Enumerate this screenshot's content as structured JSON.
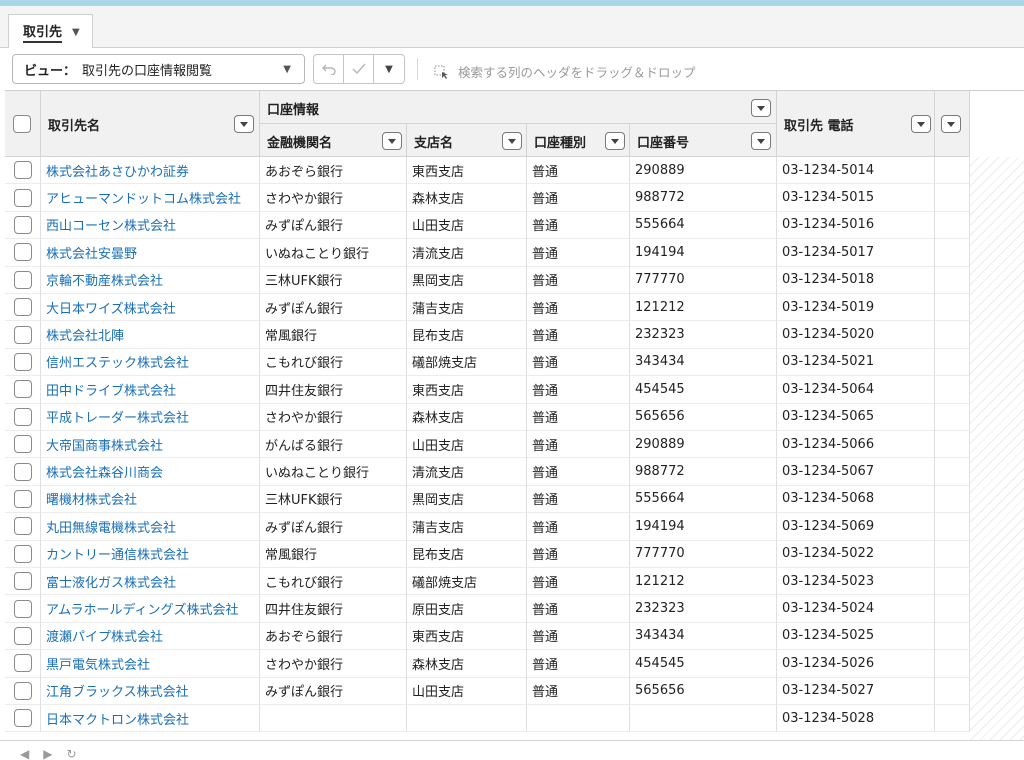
{
  "tabbar": {
    "tab_label": "取引先"
  },
  "toolbar": {
    "view_prefix": "ビュー：",
    "view_value": "取引先の口座情報閲覧",
    "drop_hint": "検索する列のヘッダをドラッグ＆ドロップ"
  },
  "grid": {
    "columns": {
      "name": "取引先名",
      "group": "口座情報",
      "bank": "金融機関名",
      "branch": "支店名",
      "type": "口座種別",
      "number": "口座番号",
      "phone": "取引先 電話"
    },
    "rows": [
      {
        "name": "株式会社あさひかわ証券",
        "bank": "あおぞら銀行",
        "branch": "東西支店",
        "type": "普通",
        "number": "290889",
        "phone": "03-1234-5014"
      },
      {
        "name": "アヒューマンドットコム株式会社",
        "bank": "さわやか銀行",
        "branch": "森林支店",
        "type": "普通",
        "number": "988772",
        "phone": "03-1234-5015"
      },
      {
        "name": "西山コーセン株式会社",
        "bank": "みずぽん銀行",
        "branch": "山田支店",
        "type": "普通",
        "number": "555664",
        "phone": "03-1234-5016"
      },
      {
        "name": "株式会社安曇野",
        "bank": "いぬねことり銀行",
        "branch": "清流支店",
        "type": "普通",
        "number": "194194",
        "phone": "03-1234-5017"
      },
      {
        "name": "京輪不動産株式会社",
        "bank": "三林UFK銀行",
        "branch": "黒岡支店",
        "type": "普通",
        "number": "777770",
        "phone": "03-1234-5018"
      },
      {
        "name": "大日本ワイズ株式会社",
        "bank": "みずぽん銀行",
        "branch": "蒲吉支店",
        "type": "普通",
        "number": "121212",
        "phone": "03-1234-5019"
      },
      {
        "name": "株式会社北陣",
        "bank": "常風銀行",
        "branch": "昆布支店",
        "type": "普通",
        "number": "232323",
        "phone": "03-1234-5020"
      },
      {
        "name": "信州エステック株式会社",
        "bank": "こもれび銀行",
        "branch": "礒部焼支店",
        "type": "普通",
        "number": "343434",
        "phone": "03-1234-5021"
      },
      {
        "name": "田中ドライブ株式会社",
        "bank": "四井住友銀行",
        "branch": "東西支店",
        "type": "普通",
        "number": "454545",
        "phone": "03-1234-5064"
      },
      {
        "name": "平成トレーダー株式会社",
        "bank": "さわやか銀行",
        "branch": "森林支店",
        "type": "普通",
        "number": "565656",
        "phone": "03-1234-5065"
      },
      {
        "name": "大帝国商事株式会社",
        "bank": "がんばる銀行",
        "branch": "山田支店",
        "type": "普通",
        "number": "290889",
        "phone": "03-1234-5066"
      },
      {
        "name": "株式会社森谷川商会",
        "bank": "いぬねことり銀行",
        "branch": "清流支店",
        "type": "普通",
        "number": "988772",
        "phone": "03-1234-5067"
      },
      {
        "name": "曙機材株式会社",
        "bank": "三林UFK銀行",
        "branch": "黒岡支店",
        "type": "普通",
        "number": "555664",
        "phone": "03-1234-5068"
      },
      {
        "name": "丸田無線電機株式会社",
        "bank": "みずぽん銀行",
        "branch": "蒲吉支店",
        "type": "普通",
        "number": "194194",
        "phone": "03-1234-5069"
      },
      {
        "name": "カントリー通信株式会社",
        "bank": "常風銀行",
        "branch": "昆布支店",
        "type": "普通",
        "number": "777770",
        "phone": "03-1234-5022"
      },
      {
        "name": "富士液化ガス株式会社",
        "bank": "こもれび銀行",
        "branch": "礒部焼支店",
        "type": "普通",
        "number": "121212",
        "phone": "03-1234-5023"
      },
      {
        "name": "アムラホールディングズ株式会社",
        "bank": "四井住友銀行",
        "branch": "原田支店",
        "type": "普通",
        "number": "232323",
        "phone": "03-1234-5024"
      },
      {
        "name": "渡瀬パイプ株式会社",
        "bank": "あおぞら銀行",
        "branch": "東西支店",
        "type": "普通",
        "number": "343434",
        "phone": "03-1234-5025"
      },
      {
        "name": "黒戸電気株式会社",
        "bank": "さわやか銀行",
        "branch": "森林支店",
        "type": "普通",
        "number": "454545",
        "phone": "03-1234-5026"
      },
      {
        "name": "江角ブラックス株式会社",
        "bank": "みずぽん銀行",
        "branch": "山田支店",
        "type": "普通",
        "number": "565656",
        "phone": "03-1234-5027"
      },
      {
        "name": "日本マクトロン株式会社",
        "bank": "",
        "branch": "",
        "type": "",
        "number": "",
        "phone": "03-1234-5028"
      }
    ]
  },
  "footer": {
    "nav_icons": [
      "prev-icon",
      "next-icon",
      "refresh-icon"
    ]
  }
}
